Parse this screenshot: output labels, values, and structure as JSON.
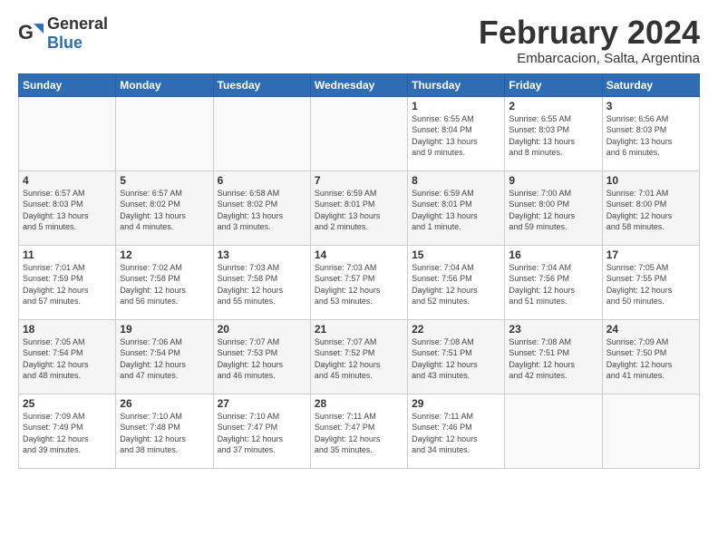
{
  "logo": {
    "general": "General",
    "blue": "Blue"
  },
  "header": {
    "month": "February 2024",
    "location": "Embarcacion, Salta, Argentina"
  },
  "weekdays": [
    "Sunday",
    "Monday",
    "Tuesday",
    "Wednesday",
    "Thursday",
    "Friday",
    "Saturday"
  ],
  "weeks": [
    [
      {
        "day": "",
        "info": ""
      },
      {
        "day": "",
        "info": ""
      },
      {
        "day": "",
        "info": ""
      },
      {
        "day": "",
        "info": ""
      },
      {
        "day": "1",
        "info": "Sunrise: 6:55 AM\nSunset: 8:04 PM\nDaylight: 13 hours\nand 9 minutes."
      },
      {
        "day": "2",
        "info": "Sunrise: 6:55 AM\nSunset: 8:03 PM\nDaylight: 13 hours\nand 8 minutes."
      },
      {
        "day": "3",
        "info": "Sunrise: 6:56 AM\nSunset: 8:03 PM\nDaylight: 13 hours\nand 6 minutes."
      }
    ],
    [
      {
        "day": "4",
        "info": "Sunrise: 6:57 AM\nSunset: 8:03 PM\nDaylight: 13 hours\nand 5 minutes."
      },
      {
        "day": "5",
        "info": "Sunrise: 6:57 AM\nSunset: 8:02 PM\nDaylight: 13 hours\nand 4 minutes."
      },
      {
        "day": "6",
        "info": "Sunrise: 6:58 AM\nSunset: 8:02 PM\nDaylight: 13 hours\nand 3 minutes."
      },
      {
        "day": "7",
        "info": "Sunrise: 6:59 AM\nSunset: 8:01 PM\nDaylight: 13 hours\nand 2 minutes."
      },
      {
        "day": "8",
        "info": "Sunrise: 6:59 AM\nSunset: 8:01 PM\nDaylight: 13 hours\nand 1 minute."
      },
      {
        "day": "9",
        "info": "Sunrise: 7:00 AM\nSunset: 8:00 PM\nDaylight: 12 hours\nand 59 minutes."
      },
      {
        "day": "10",
        "info": "Sunrise: 7:01 AM\nSunset: 8:00 PM\nDaylight: 12 hours\nand 58 minutes."
      }
    ],
    [
      {
        "day": "11",
        "info": "Sunrise: 7:01 AM\nSunset: 7:59 PM\nDaylight: 12 hours\nand 57 minutes."
      },
      {
        "day": "12",
        "info": "Sunrise: 7:02 AM\nSunset: 7:58 PM\nDaylight: 12 hours\nand 56 minutes."
      },
      {
        "day": "13",
        "info": "Sunrise: 7:03 AM\nSunset: 7:58 PM\nDaylight: 12 hours\nand 55 minutes."
      },
      {
        "day": "14",
        "info": "Sunrise: 7:03 AM\nSunset: 7:57 PM\nDaylight: 12 hours\nand 53 minutes."
      },
      {
        "day": "15",
        "info": "Sunrise: 7:04 AM\nSunset: 7:56 PM\nDaylight: 12 hours\nand 52 minutes."
      },
      {
        "day": "16",
        "info": "Sunrise: 7:04 AM\nSunset: 7:56 PM\nDaylight: 12 hours\nand 51 minutes."
      },
      {
        "day": "17",
        "info": "Sunrise: 7:05 AM\nSunset: 7:55 PM\nDaylight: 12 hours\nand 50 minutes."
      }
    ],
    [
      {
        "day": "18",
        "info": "Sunrise: 7:05 AM\nSunset: 7:54 PM\nDaylight: 12 hours\nand 48 minutes."
      },
      {
        "day": "19",
        "info": "Sunrise: 7:06 AM\nSunset: 7:54 PM\nDaylight: 12 hours\nand 47 minutes."
      },
      {
        "day": "20",
        "info": "Sunrise: 7:07 AM\nSunset: 7:53 PM\nDaylight: 12 hours\nand 46 minutes."
      },
      {
        "day": "21",
        "info": "Sunrise: 7:07 AM\nSunset: 7:52 PM\nDaylight: 12 hours\nand 45 minutes."
      },
      {
        "day": "22",
        "info": "Sunrise: 7:08 AM\nSunset: 7:51 PM\nDaylight: 12 hours\nand 43 minutes."
      },
      {
        "day": "23",
        "info": "Sunrise: 7:08 AM\nSunset: 7:51 PM\nDaylight: 12 hours\nand 42 minutes."
      },
      {
        "day": "24",
        "info": "Sunrise: 7:09 AM\nSunset: 7:50 PM\nDaylight: 12 hours\nand 41 minutes."
      }
    ],
    [
      {
        "day": "25",
        "info": "Sunrise: 7:09 AM\nSunset: 7:49 PM\nDaylight: 12 hours\nand 39 minutes."
      },
      {
        "day": "26",
        "info": "Sunrise: 7:10 AM\nSunset: 7:48 PM\nDaylight: 12 hours\nand 38 minutes."
      },
      {
        "day": "27",
        "info": "Sunrise: 7:10 AM\nSunset: 7:47 PM\nDaylight: 12 hours\nand 37 minutes."
      },
      {
        "day": "28",
        "info": "Sunrise: 7:11 AM\nSunset: 7:47 PM\nDaylight: 12 hours\nand 35 minutes."
      },
      {
        "day": "29",
        "info": "Sunrise: 7:11 AM\nSunset: 7:46 PM\nDaylight: 12 hours\nand 34 minutes."
      },
      {
        "day": "",
        "info": ""
      },
      {
        "day": "",
        "info": ""
      }
    ]
  ]
}
